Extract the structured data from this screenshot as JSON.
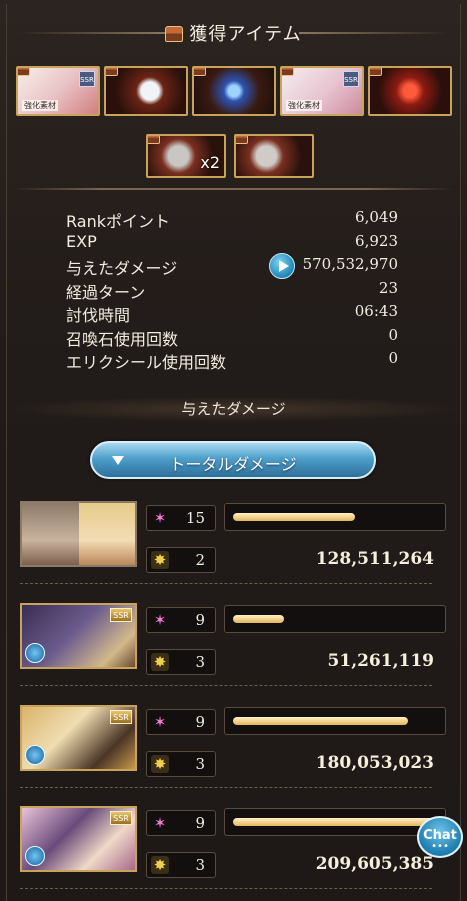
{
  "header": {
    "title": "獲得アイテム"
  },
  "items": [
    {
      "name": "強化素材 SSR",
      "rarity": "SSR",
      "tag": "強化素材",
      "art": "linear-gradient(135deg,#f6efe9,#e9c3c6 50%,#d27f7f)"
    },
    {
      "name": "orb",
      "rarity": "",
      "tag": "",
      "art": "radial-gradient(circle at 55% 50%,#f0f4f8 0 18%,#6b2415 28%,#2a100b 70%)"
    },
    {
      "name": "blue crystal",
      "rarity": "",
      "tag": "",
      "art": "radial-gradient(circle at 50% 50%,#9fd2ff 0 12%,#2d53b0 22%,#3a1a12 55%,#1d0f0a)"
    },
    {
      "name": "強化素材 SSR 2",
      "rarity": "SSR",
      "tag": "強化素材",
      "art": "linear-gradient(135deg,#f5eef0,#e7c2cf 55%,#cc8a9c)"
    },
    {
      "name": "red item",
      "rarity": "",
      "tag": "",
      "art": "radial-gradient(circle at 50% 50%,#ff5a3a 0 14%,#8d1b12 30%,#2a0f0a 70%)"
    }
  ],
  "items_row2": [
    {
      "name": "character orb x2",
      "qty": "x2",
      "art": "radial-gradient(circle at 40% 50%,#c9c7c4 0 20%,#7a2f20 34%,#2a120c 70%)"
    },
    {
      "name": "character orb",
      "qty": "",
      "art": "radial-gradient(circle at 40% 50%,#cfcbc6 0 20%,#7a2f20 34%,#2a120c 70%)"
    }
  ],
  "stats": [
    {
      "label": "Rankポイント",
      "value": "6,049"
    },
    {
      "label": "EXP",
      "value": "6,923"
    },
    {
      "label": "与えたダメージ",
      "value": "570,532,970"
    },
    {
      "label": "経過ターン",
      "value": "23"
    },
    {
      "label": "討伐時間",
      "value": "06:43"
    },
    {
      "label": "召喚石使用回数",
      "value": "0"
    },
    {
      "label": "エリクシール使用回数",
      "value": "0"
    }
  ],
  "section_title": "与えたダメージ",
  "total_button": "トータルダメージ",
  "rows": [
    {
      "hits": "15",
      "ougi": "2",
      "damage": "128,511,264",
      "bar": 0.6,
      "ssr": "",
      "dual": true
    },
    {
      "hits": "9",
      "ougi": "3",
      "damage": "51,261,119",
      "bar": 0.25,
      "ssr": "SSR",
      "dual": false
    },
    {
      "hits": "9",
      "ougi": "3",
      "damage": "180,053,023",
      "bar": 0.86,
      "ssr": "SSR",
      "dual": false
    },
    {
      "hits": "9",
      "ougi": "3",
      "damage": "209,605,385",
      "bar": 1.0,
      "ssr": "SSR",
      "dual": false
    }
  ],
  "chat": {
    "label": "Chat",
    "dots": "•••"
  },
  "colors": {
    "gold": "#c9a35a",
    "bar": "#e4b55a",
    "accent_blue": "#4f9fcb"
  }
}
